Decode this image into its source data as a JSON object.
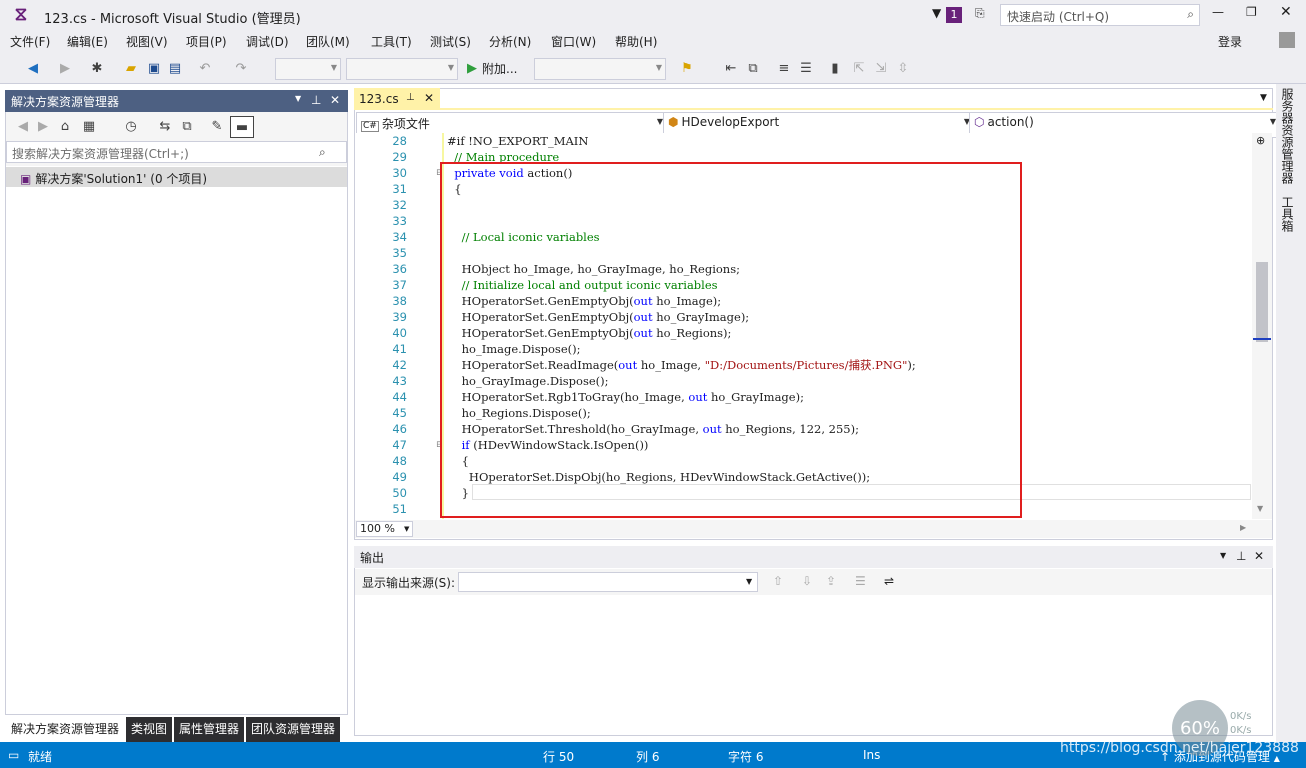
{
  "window": {
    "title": "123.cs - Microsoft Visual Studio (管理员)",
    "notification_count": "1",
    "quick_launch_placeholder": "快速启动 (Ctrl+Q)",
    "signin": "登录"
  },
  "menu": [
    "文件(F)",
    "编辑(E)",
    "视图(V)",
    "项目(P)",
    "调试(D)",
    "团队(M)",
    "工具(T)",
    "测试(S)",
    "分析(N)",
    "窗口(W)",
    "帮助(H)"
  ],
  "toolbar": {
    "attach_label": "附加...",
    "icons": [
      "back-icon",
      "forward-icon",
      "new-project-icon",
      "open-file-icon",
      "save-icon",
      "save-all-icon",
      "undo-icon",
      "redo-icon"
    ]
  },
  "solution_explorer": {
    "title": "解决方案资源管理器",
    "search_placeholder": "搜索解决方案资源管理器(Ctrl+;)",
    "root_node": "解决方案'Solution1' (0 个项目)"
  },
  "bottom_tabs": [
    "解决方案资源管理器",
    "类视图",
    "属性管理器",
    "团队资源管理器"
  ],
  "editor": {
    "tab_name": "123.cs",
    "nav_project": "杂项文件",
    "nav_class": "HDevelopExport",
    "nav_member": "action()",
    "zoom": "100 %",
    "lines": [
      {
        "n": "28",
        "segs": [
          {
            "t": "#if !NO_EXPORT_MAIN",
            "c": ""
          }
        ]
      },
      {
        "n": "29",
        "segs": [
          {
            "t": "  // Main procedure",
            "c": "cm"
          }
        ]
      },
      {
        "n": "30",
        "segs": [
          {
            "t": "  ",
            "c": ""
          },
          {
            "t": "private void",
            "c": "kw"
          },
          {
            "t": " action()",
            "c": ""
          }
        ]
      },
      {
        "n": "31",
        "segs": [
          {
            "t": "  {",
            "c": ""
          }
        ]
      },
      {
        "n": "32",
        "segs": []
      },
      {
        "n": "33",
        "segs": []
      },
      {
        "n": "34",
        "segs": [
          {
            "t": "    // Local iconic variables",
            "c": "cm"
          }
        ]
      },
      {
        "n": "35",
        "segs": []
      },
      {
        "n": "36",
        "segs": [
          {
            "t": "    HObject ho_Image, ho_GrayImage, ho_Regions;",
            "c": ""
          }
        ]
      },
      {
        "n": "37",
        "segs": [
          {
            "t": "    // Initialize local and output iconic variables",
            "c": "cm"
          }
        ]
      },
      {
        "n": "38",
        "segs": [
          {
            "t": "    HOperatorSet.GenEmptyObj(",
            "c": ""
          },
          {
            "t": "out",
            "c": "kw"
          },
          {
            "t": " ho_Image);",
            "c": ""
          }
        ]
      },
      {
        "n": "39",
        "segs": [
          {
            "t": "    HOperatorSet.GenEmptyObj(",
            "c": ""
          },
          {
            "t": "out",
            "c": "kw"
          },
          {
            "t": " ho_GrayImage);",
            "c": ""
          }
        ]
      },
      {
        "n": "40",
        "segs": [
          {
            "t": "    HOperatorSet.GenEmptyObj(",
            "c": ""
          },
          {
            "t": "out",
            "c": "kw"
          },
          {
            "t": " ho_Regions);",
            "c": ""
          }
        ]
      },
      {
        "n": "41",
        "segs": [
          {
            "t": "    ho_Image.Dispose();",
            "c": ""
          }
        ]
      },
      {
        "n": "42",
        "segs": [
          {
            "t": "    HOperatorSet.ReadImage(",
            "c": ""
          },
          {
            "t": "out",
            "c": "kw"
          },
          {
            "t": " ho_Image, ",
            "c": ""
          },
          {
            "t": "\"D:/Documents/Pictures/捕获.PNG\"",
            "c": "str"
          },
          {
            "t": ");",
            "c": ""
          }
        ]
      },
      {
        "n": "43",
        "segs": [
          {
            "t": "    ho_GrayImage.Dispose();",
            "c": ""
          }
        ]
      },
      {
        "n": "44",
        "segs": [
          {
            "t": "    HOperatorSet.Rgb1ToGray(ho_Image, ",
            "c": ""
          },
          {
            "t": "out",
            "c": "kw"
          },
          {
            "t": " ho_GrayImage);",
            "c": ""
          }
        ]
      },
      {
        "n": "45",
        "segs": [
          {
            "t": "    ho_Regions.Dispose();",
            "c": ""
          }
        ]
      },
      {
        "n": "46",
        "segs": [
          {
            "t": "    HOperatorSet.Threshold(ho_GrayImage, ",
            "c": ""
          },
          {
            "t": "out",
            "c": "kw"
          },
          {
            "t": " ho_Regions, 122, 255);",
            "c": ""
          }
        ]
      },
      {
        "n": "47",
        "segs": [
          {
            "t": "    ",
            "c": ""
          },
          {
            "t": "if",
            "c": "kw"
          },
          {
            "t": " (HDevWindowStack.IsOpen())",
            "c": ""
          }
        ]
      },
      {
        "n": "48",
        "segs": [
          {
            "t": "    {",
            "c": ""
          }
        ]
      },
      {
        "n": "49",
        "segs": [
          {
            "t": "      HOperatorSet.DispObj(ho_Regions, HDevWindowStack.GetActive());",
            "c": ""
          }
        ]
      },
      {
        "n": "50",
        "segs": [
          {
            "t": "    }",
            "c": ""
          }
        ]
      },
      {
        "n": "51",
        "segs": []
      }
    ]
  },
  "output": {
    "title": "输出",
    "source_label": "显示输出来源(S):",
    "source_value": ""
  },
  "side_tabs": [
    "服务器资源管理器",
    "工具箱"
  ],
  "status": {
    "ready": "就绪",
    "line": "行 50",
    "col": "列 6",
    "char": "字符 6",
    "mode": "Ins",
    "source_control": "添加到源代码管理"
  },
  "overlay": {
    "watermark": "https://blog.csdn.net/hajer123888",
    "net_percent": "60%",
    "up": "0K/s",
    "down": "0K/s"
  },
  "colors": {
    "accent": "#007acc",
    "highlight_box": "#e01e1e",
    "keyword": "#0000ff",
    "comment": "#008000",
    "string": "#a31515"
  }
}
